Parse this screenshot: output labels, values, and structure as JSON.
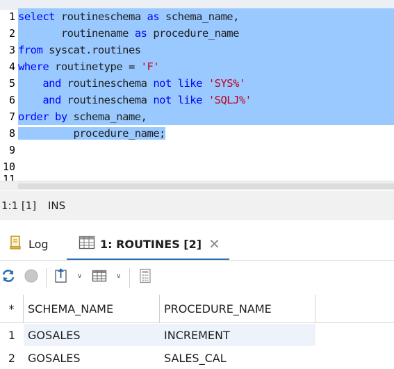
{
  "editor": {
    "line_numbers": [
      "1",
      "2",
      "3",
      "4",
      "5",
      "6",
      "7",
      "8",
      "9",
      "10",
      "11"
    ],
    "lines": [
      [
        {
          "t": "select",
          "k": "kw"
        },
        {
          "t": " routineschema "
        },
        {
          "t": "as",
          "k": "kw"
        },
        {
          "t": " schema_name,"
        }
      ],
      [
        {
          "t": "       routinename "
        },
        {
          "t": "as",
          "k": "kw"
        },
        {
          "t": " procedure_name"
        }
      ],
      [
        {
          "t": "from",
          "k": "kw"
        },
        {
          "t": " syscat.routines"
        }
      ],
      [
        {
          "t": "where",
          "k": "kw"
        },
        {
          "t": " routinetype = "
        },
        {
          "t": "'F'",
          "k": "str"
        }
      ],
      [
        {
          "t": "    "
        },
        {
          "t": "and",
          "k": "kw"
        },
        {
          "t": " routineschema "
        },
        {
          "t": "not like",
          "k": "kw"
        },
        {
          "t": " "
        },
        {
          "t": "'SYS%'",
          "k": "str"
        }
      ],
      [
        {
          "t": "    "
        },
        {
          "t": "and",
          "k": "kw"
        },
        {
          "t": " routineschema "
        },
        {
          "t": "not like",
          "k": "kw"
        },
        {
          "t": " "
        },
        {
          "t": "'SQLJ%'",
          "k": "str"
        }
      ],
      [
        {
          "t": "order by",
          "k": "kw"
        },
        {
          "t": " schema_name,"
        }
      ],
      [
        {
          "t": "         procedure_name;"
        }
      ],
      [],
      []
    ]
  },
  "status": {
    "position": "1:1 [1]",
    "mode": "INS"
  },
  "tabs": {
    "log_label": "Log",
    "routines_label": "1: ROUTINES [2]",
    "close_glyph": "✕"
  },
  "grid": {
    "corner": "*",
    "columns": [
      "SCHEMA_NAME",
      "PROCEDURE_NAME"
    ],
    "rows": [
      {
        "num": "1",
        "schema_name": "GOSALES",
        "procedure_name": "INCREMENT"
      },
      {
        "num": "2",
        "schema_name": "GOSALES",
        "procedure_name": "SALES_CAL"
      }
    ]
  },
  "colors": {
    "selection": "#99c9ff",
    "keyword": "#0000ff",
    "string": "#c0001f",
    "active_tab_underline": "#2f6fb5"
  }
}
